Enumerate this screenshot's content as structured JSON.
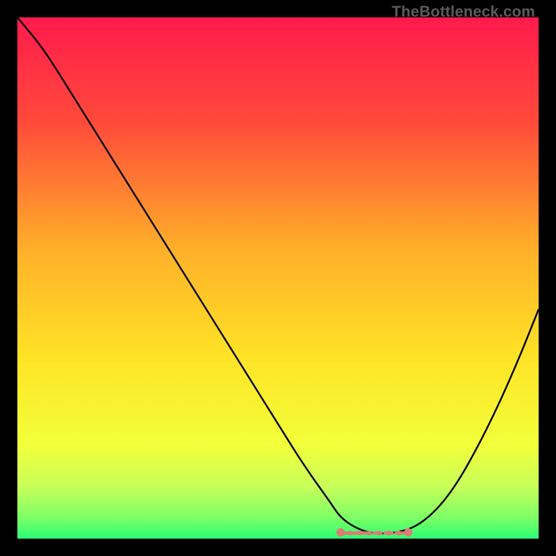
{
  "watermark": "TheBottleneck.com",
  "chart_data": {
    "type": "line",
    "title": "",
    "xlabel": "",
    "ylabel": "",
    "xlim": [
      0,
      100
    ],
    "ylim": [
      0,
      100
    ],
    "grid": false,
    "legend": false,
    "series": [
      {
        "name": "bottleneck-curve",
        "x": [
          0,
          5,
          10,
          15,
          20,
          25,
          30,
          35,
          40,
          45,
          50,
          55,
          60,
          62,
          65,
          68,
          72,
          76,
          80,
          84,
          88,
          92,
          96,
          100
        ],
        "values": [
          100,
          94,
          86,
          78,
          70,
          62,
          54,
          46,
          38,
          30,
          22,
          14,
          7,
          4,
          2,
          1,
          1,
          2,
          5,
          10,
          17,
          25,
          34,
          44
        ]
      }
    ],
    "markers": {
      "optimal_range_x": [
        62,
        75
      ],
      "optimal_color": "#dd7c76"
    },
    "background_gradient": {
      "type": "vertical",
      "stops": [
        {
          "pos": 0.0,
          "color": "#ff1a4d"
        },
        {
          "pos": 0.2,
          "color": "#ff4a3a"
        },
        {
          "pos": 0.45,
          "color": "#ffb129"
        },
        {
          "pos": 0.65,
          "color": "#ffe326"
        },
        {
          "pos": 0.82,
          "color": "#f2ff3a"
        },
        {
          "pos": 0.9,
          "color": "#c8ff5a"
        },
        {
          "pos": 0.96,
          "color": "#7dff66"
        },
        {
          "pos": 1.0,
          "color": "#2bff74"
        }
      ]
    }
  }
}
